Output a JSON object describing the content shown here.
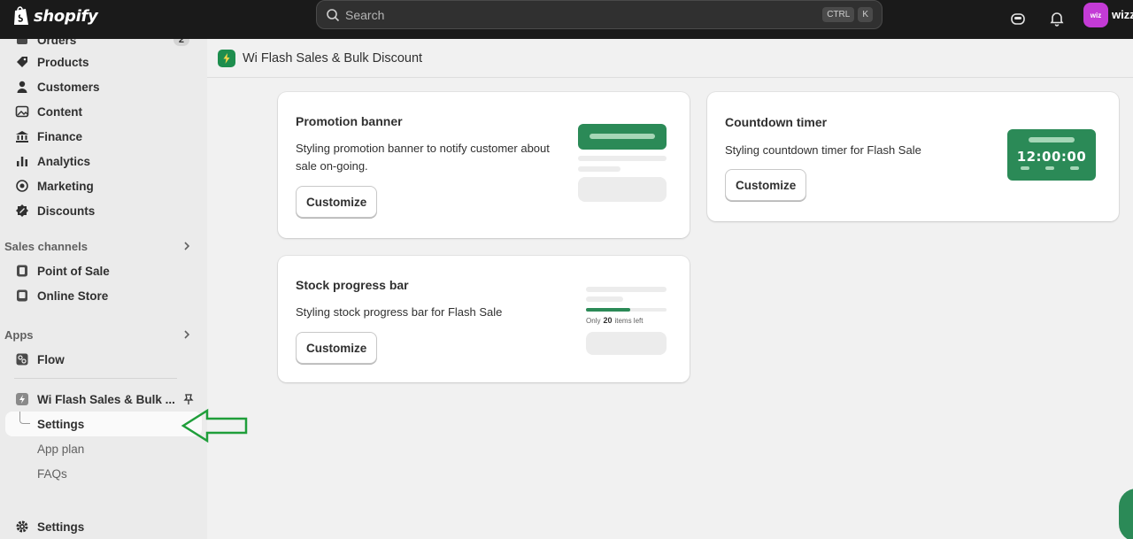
{
  "topbar": {
    "logo_text": "shopify",
    "search_placeholder": "Search",
    "kbd_ctrl": "CTRL",
    "kbd_k": "K",
    "avatar_initials": "wiz",
    "store_name": "wizz"
  },
  "sidebar": {
    "orders_label": "Orders",
    "orders_badge": "2",
    "items": [
      {
        "label": "Products",
        "icon": "tag-icon"
      },
      {
        "label": "Customers",
        "icon": "person-icon"
      },
      {
        "label": "Content",
        "icon": "image-icon"
      },
      {
        "label": "Finance",
        "icon": "bank-icon"
      },
      {
        "label": "Analytics",
        "icon": "bar-chart-icon"
      },
      {
        "label": "Marketing",
        "icon": "target-icon"
      },
      {
        "label": "Discounts",
        "icon": "discount-icon"
      }
    ],
    "sales_channels_label": "Sales channels",
    "sales_channels": [
      {
        "label": "Point of Sale",
        "icon": "pos-icon"
      },
      {
        "label": "Online Store",
        "icon": "store-icon"
      }
    ],
    "apps_label": "Apps",
    "apps": [
      {
        "label": "Flow",
        "icon": "flow-icon"
      }
    ],
    "app_name": "Wi Flash Sales & Bulk ...",
    "app_subitems": {
      "settings": "Settings",
      "app_plan": "App plan",
      "faqs": "FAQs"
    },
    "bottom_settings": "Settings"
  },
  "page": {
    "title": "Wi Flash Sales & Bulk Discount"
  },
  "cards": {
    "promotion": {
      "title": "Promotion banner",
      "description": "Styling promotion banner to notify customer about sale on-going.",
      "button": "Customize"
    },
    "countdown": {
      "title": "Countdown timer",
      "description": "Styling countdown timer for Flash Sale",
      "button": "Customize",
      "timer_text": "12:00:00"
    },
    "stock": {
      "title": "Stock progress bar",
      "description": "Styling stock progress bar for Flash Sale",
      "button": "Customize",
      "label_prefix": "Only",
      "label_count": "20",
      "label_suffix": "items left",
      "progress_fraction": 0.55
    }
  },
  "colors": {
    "accent_green": "#2b8a57",
    "avatar_purple": "#c43bd6",
    "annotation_arrow": "#1f9e3a"
  }
}
